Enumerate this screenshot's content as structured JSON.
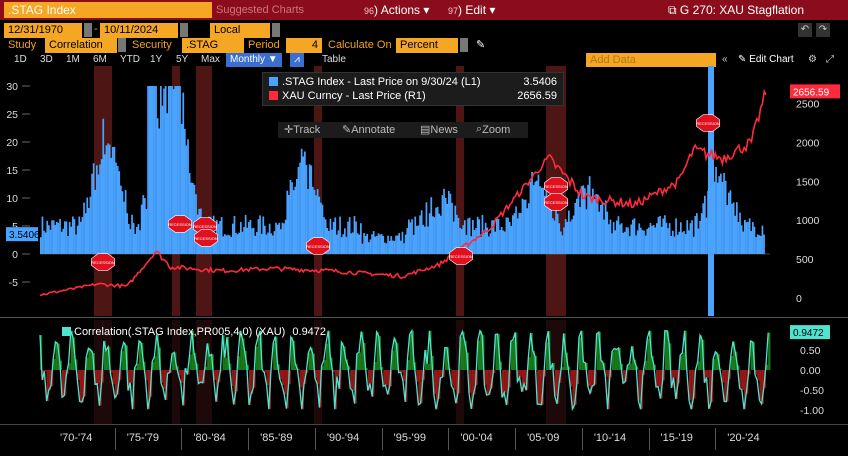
{
  "topbar": {
    "security_name": ".STAG Index",
    "menu_faded": "Suggested Charts",
    "actions_label": "Actions",
    "actions_num": "96",
    "edit_label": "Edit",
    "edit_num": "97",
    "title": "G 270: XAU Stagflation"
  },
  "dates": {
    "start": "12/31/1970",
    "end": "10/11/2024",
    "currency": "Local CCY"
  },
  "study": {
    "study_label": "Study",
    "study_value": "Correlation",
    "security_label": "Security",
    "security_value": ".STAG Inde",
    "period_label": "Period",
    "period_value": "4",
    "calc_label": "Calculate On",
    "calc_value": "Percent"
  },
  "range_buttons": [
    "1D",
    "3D",
    "1M",
    "6M",
    "YTD",
    "1Y",
    "5Y",
    "Max"
  ],
  "frequency": "Monthly",
  "table_label": "Table",
  "add_data_placeholder": "Add Data",
  "edit_chart_label": "Edit Chart",
  "legend": {
    "stag_label": ".STAG Index - Last Price on 9/30/24 (L1)",
    "stag_value": "3.5406",
    "xau_label": "XAU Curncy - Last Price (R1)",
    "xau_value": "2656.59"
  },
  "tools": [
    "Track",
    "Annotate",
    "News",
    "Zoom"
  ],
  "left_axis": [
    "30",
    "25",
    "20",
    "15",
    "10",
    "5",
    "0",
    "-5"
  ],
  "right_axis": [
    "2500",
    "2000",
    "1500",
    "1000",
    "500",
    "0"
  ],
  "stag_marker": "3.5406",
  "xau_marker": "2656.59",
  "recession_label": "RECESSION",
  "lower": {
    "title": "Correlation(.STAG Index,PR005,4,0) (XAU)",
    "title_value": "0.9472",
    "marker": "0.9472",
    "axis": [
      "0.50",
      "0.00",
      "-0.50",
      "-1.00"
    ]
  },
  "x_labels": [
    "'70-'74",
    "'75-'79",
    "'80-'84",
    "'85-'89",
    "'90-'94",
    "'95-'99",
    "'00-'04",
    "'05-'09",
    "'10-'14",
    "'15-'19",
    "'20-'24"
  ],
  "colors": {
    "stag": "#4aa3ff",
    "xau": "#ff2a3c",
    "accent": "#f5a623",
    "topbar": "#8b0d1c",
    "corr_line": "#4fe3d0",
    "corr_fill": "#1e8f1e",
    "corr_neg": "#b01a1a"
  }
}
